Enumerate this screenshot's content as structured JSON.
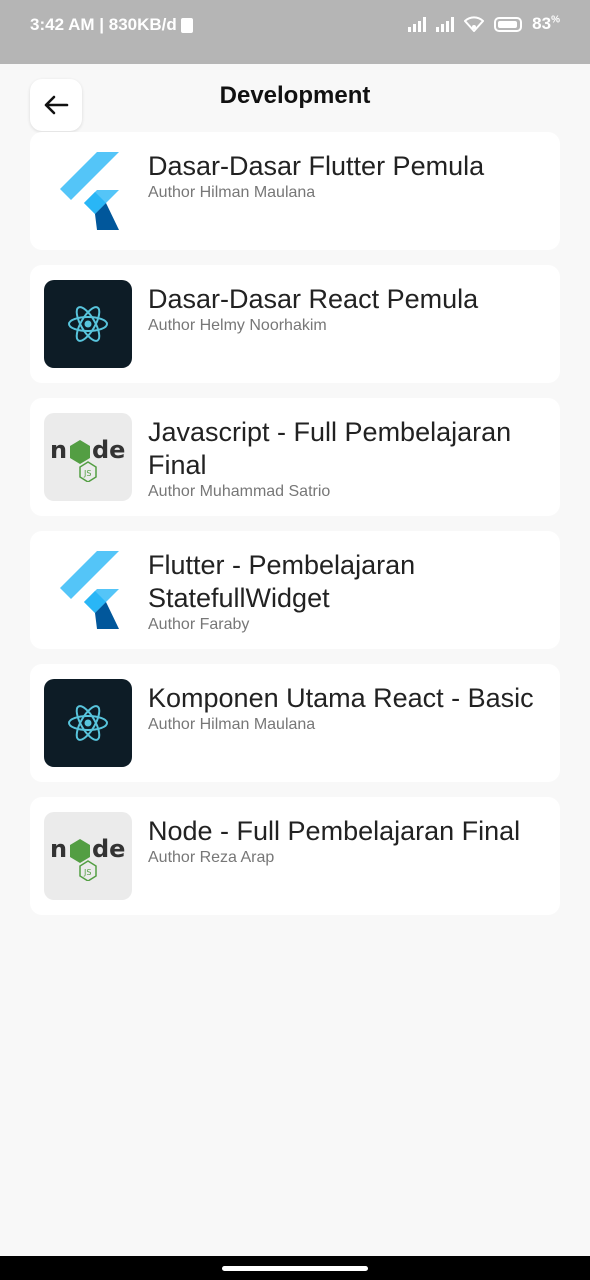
{
  "status_bar": {
    "time_speed": "3:42 AM | 830KB/d",
    "battery": "83",
    "battery_unit": "%"
  },
  "header": {
    "title": "Development",
    "back_icon": "arrow-left-icon"
  },
  "courses": [
    {
      "title": "Dasar-Dasar Flutter Pemula",
      "author": "Author Hilman Maulana",
      "logo": "flutter-logo-icon"
    },
    {
      "title": "Dasar-Dasar React Pemula",
      "author": "Author Helmy Noorhakim",
      "logo": "react-logo-icon"
    },
    {
      "title": "Javascript -  Full Pembelajaran Final",
      "author": "Author Muhammad Satrio",
      "logo": "nodejs-logo-icon"
    },
    {
      "title": "Flutter - Pembelajaran StatefullWidget",
      "author": "Author Faraby",
      "logo": "flutter-logo-icon"
    },
    {
      "title": "Komponen Utama React - Basic",
      "author": "Author Hilman Maulana",
      "logo": "react-logo-icon"
    },
    {
      "title": "Node - Full Pembelajaran Final",
      "author": "Author Reza Arap",
      "logo": "nodejs-logo-icon"
    }
  ],
  "colors": {
    "background": "#f8f8f8",
    "card": "#ffffff",
    "react_bg": "#0d1c26",
    "react_accent": "#58c4dc",
    "node_green": "#539e43",
    "flutter_light": "#54c5f8",
    "flutter_dark": "#01579b"
  }
}
